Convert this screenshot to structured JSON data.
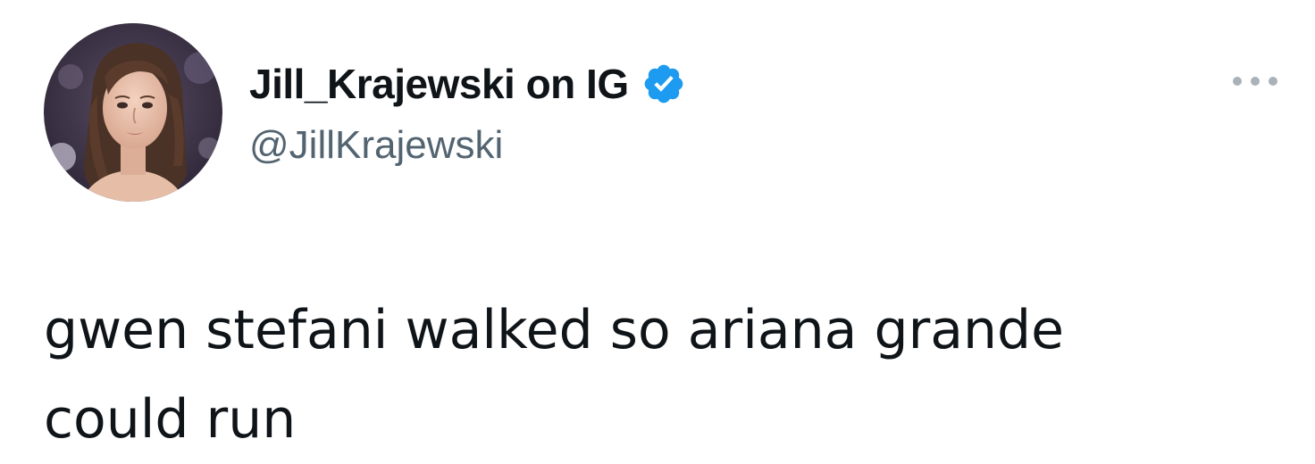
{
  "tweet": {
    "author": {
      "display_name": "Jill_Krajewski on IG",
      "handle": "@JillKrajewski",
      "verified": true,
      "avatar_icon": "profile-photo",
      "verified_icon": "verified-badge-icon",
      "verified_color": "#1d9bf0"
    },
    "menu_icon": "more-options-icon",
    "text": "gwen stefani walked so ariana grande\ncould run"
  },
  "colors": {
    "background": "#ffffff",
    "primary_text": "#0f1419",
    "secondary_text": "#536471",
    "accent": "#1d9bf0"
  }
}
